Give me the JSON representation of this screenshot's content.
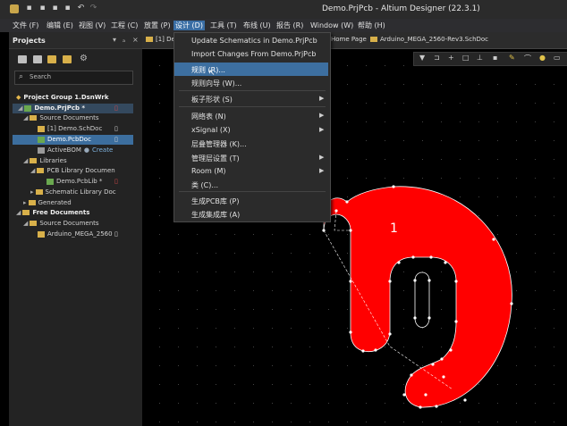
{
  "window": {
    "title": "Demo.PrjPcb - Altium Designer (22.3.1)"
  },
  "menubar": {
    "items": [
      "文件 (F)",
      "编辑 (E)",
      "视图 (V)",
      "工程 (C)",
      "放置 (P)",
      "设计 (D)",
      "工具 (T)",
      "布线 (U)",
      "报告 (R)",
      "Window (W)",
      "帮助 (H)"
    ],
    "active": "设计 (D)"
  },
  "panel": {
    "title": "Projects",
    "header_buttons": [
      "▾",
      "ₐ",
      "×"
    ],
    "search_placeholder": "Search",
    "tree": [
      "Project Group 1.DsnWrk",
      "Demo.PrjPcb *",
      "Source Documents",
      "[1] Demo.SchDoc",
      "Demo.PcbDoc",
      "ActiveBOM",
      "Create",
      "Libraries",
      "PCB Library Documen",
      "Demo.PcbLib *",
      "Schematic Library Doc",
      "Generated",
      "Free Documents",
      "Source Documents",
      "Arduino_MEGA_2560"
    ]
  },
  "tabs": [
    "[1] De",
    "Home Page",
    "Arduino_MEGA_2560-Rev3.SchDoc"
  ],
  "dropdown": {
    "items": [
      {
        "label": "Update Schematics in Demo.PrjPcb",
        "submenu": false
      },
      {
        "label": "Import Changes From Demo.PrjPcb",
        "submenu": false
      },
      {
        "label": "规则 (R)...",
        "submenu": false,
        "highlighted": true
      },
      {
        "label": "规则向导 (W)...",
        "submenu": false
      },
      {
        "label": "板子形状 (S)",
        "submenu": true
      },
      {
        "label": "网络表 (N)",
        "submenu": true
      },
      {
        "label": "xSignal (X)",
        "submenu": true
      },
      {
        "label": "层叠管理器 (K)...",
        "submenu": false
      },
      {
        "label": "管理层设置 (T)",
        "submenu": true
      },
      {
        "label": "Room (M)",
        "submenu": true
      },
      {
        "label": "类 (C)...",
        "submenu": false
      },
      {
        "label": "生成PCB库 (P)",
        "submenu": false
      },
      {
        "label": "生成集成库 (A)",
        "submenu": false
      }
    ]
  },
  "canvas": {
    "pad_label": "1",
    "shape_color": "#ff0000",
    "selection_color": "#ffffff"
  },
  "icons": {
    "app": "altium-logo-icon",
    "quick_access": [
      "save-icon",
      "save-all-icon",
      "open-icon",
      "folder-icon",
      "undo-icon",
      "redo-icon"
    ],
    "panel_toolbar": [
      "save-icon",
      "compile-icon",
      "add-icon",
      "folder-icon",
      "gear-icon"
    ],
    "pcb_toolbar": [
      "filter-icon",
      "route-icon",
      "add-icon",
      "rectangle-icon",
      "place-icon",
      "line-icon",
      "pencil-icon",
      "arc-icon",
      "text-icon",
      "pad-icon"
    ]
  }
}
